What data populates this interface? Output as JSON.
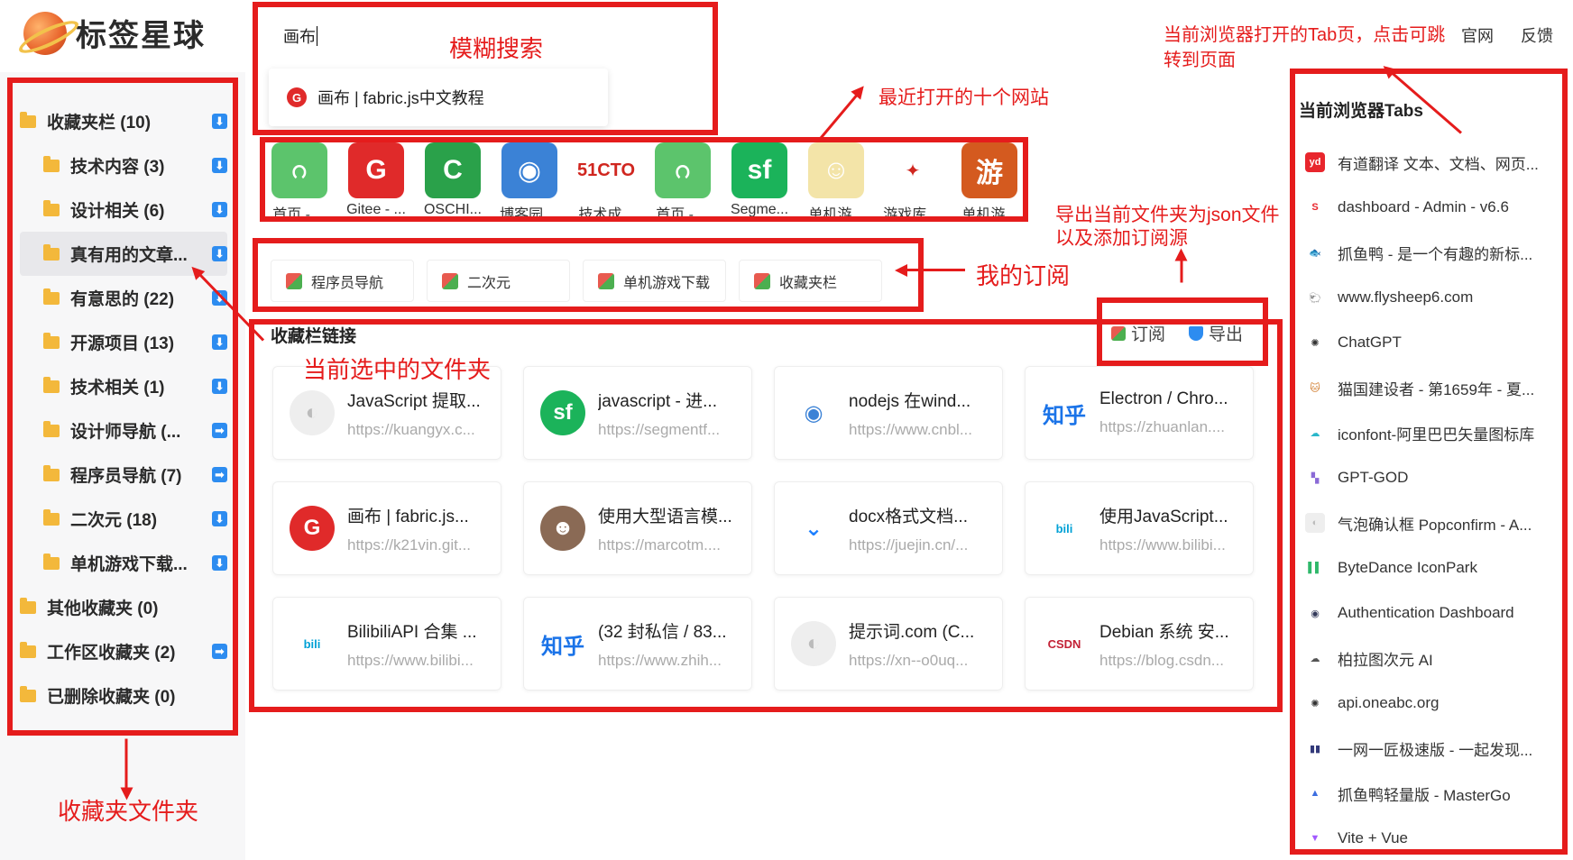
{
  "app": {
    "name": "标签星球"
  },
  "search": {
    "query": "画布",
    "result": "画布 | fabric.js中文教程"
  },
  "top_links": [
    "官网",
    "反馈"
  ],
  "sidebar": {
    "folders": [
      {
        "label": "收藏夹栏 (10)",
        "level": 0,
        "btn": "⬇"
      },
      {
        "label": "技术内容 (3)",
        "level": 1,
        "btn": "⬇"
      },
      {
        "label": "设计相关 (6)",
        "level": 1,
        "btn": "⬇"
      },
      {
        "label": "真有用的文章...",
        "level": 1,
        "btn": "⬇",
        "selected": true
      },
      {
        "label": "有意思的 (22)",
        "level": 1,
        "btn": "⬇"
      },
      {
        "label": "开源项目 (13)",
        "level": 1,
        "btn": "⬇"
      },
      {
        "label": "技术相关 (1)",
        "level": 1,
        "btn": "⬇"
      },
      {
        "label": "设计师导航 (...",
        "level": 1,
        "btn": "➡"
      },
      {
        "label": "程序员导航 (7)",
        "level": 1,
        "btn": "➡"
      },
      {
        "label": "二次元 (18)",
        "level": 1,
        "btn": "⬇"
      },
      {
        "label": "单机游戏下载...",
        "level": 1,
        "btn": "⬇"
      },
      {
        "label": "其他收藏夹 (0)",
        "level": 0,
        "btn": ""
      },
      {
        "label": "工作区收藏夹 (2)",
        "level": 0,
        "btn": "➡"
      },
      {
        "label": "已删除收藏夹 (0)",
        "level": 0,
        "btn": ""
      }
    ]
  },
  "recent_sites": [
    {
      "label": "首页 - ...",
      "glyph": "ဂ",
      "color": "#5cc46c"
    },
    {
      "label": "Gitee - ...",
      "glyph": "G",
      "color": "#e02a2a"
    },
    {
      "label": "OSCHI...",
      "glyph": "C",
      "color": "#2aa14a"
    },
    {
      "label": "博客园 ...",
      "glyph": "◉",
      "color": "#3b82d6"
    },
    {
      "label": "技术成...",
      "glyph": "51CTO",
      "color": "#ffffff"
    },
    {
      "label": "首页 - ...",
      "glyph": "ဂ",
      "color": "#5cc46c"
    },
    {
      "label": "Segme...",
      "glyph": "sf",
      "color": "#1bb35a"
    },
    {
      "label": "单机游...",
      "glyph": "☺",
      "color": "#f3e4a8"
    },
    {
      "label": "游戏库 ...",
      "glyph": "✦",
      "color": "#ffffff"
    },
    {
      "label": "单机游...",
      "glyph": "游",
      "color": "#d45a1f"
    }
  ],
  "subscriptions": [
    "程序员导航",
    "二次元",
    "单机游戏下载",
    "收藏夹栏"
  ],
  "section": {
    "title": "收藏栏链接",
    "subscribe": "订阅",
    "export": "导出"
  },
  "cards": [
    {
      "title": "JavaScript 提取...",
      "url": "https://kuangyx.c...",
      "glyph": "◐",
      "color": "#eeeeee",
      "fg": "#bbbbbb"
    },
    {
      "title": "javascript - 进...",
      "url": "https://segmentf...",
      "glyph": "sf",
      "color": "#1bb35a",
      "fg": "#ffffff"
    },
    {
      "title": "nodejs 在wind...",
      "url": "https://www.cnbl...",
      "glyph": "◉",
      "color": "#ffffff",
      "fg": "#3b82d6"
    },
    {
      "title": "Electron / Chro...",
      "url": "https://zhuanlan....",
      "glyph": "知乎",
      "color": "#ffffff",
      "fg": "#1a73e8"
    },
    {
      "title": "画布 | fabric.js...",
      "url": "https://k21vin.git...",
      "glyph": "G",
      "color": "#e02a2a",
      "fg": "#ffffff"
    },
    {
      "title": "使用大型语言模...",
      "url": "https://marcotm....",
      "glyph": "☻",
      "color": "#8a6a55",
      "fg": "#ffffff"
    },
    {
      "title": "docx格式文档...",
      "url": "https://juejin.cn/...",
      "glyph": "⌄",
      "color": "#ffffff",
      "fg": "#1e80ff"
    },
    {
      "title": "使用JavaScript...",
      "url": "https://www.bilibi...",
      "glyph": "bili",
      "color": "#ffffff",
      "fg": "#00a1d6"
    },
    {
      "title": "BilibiliAPI 合集 ...",
      "url": "https://www.bilibi...",
      "glyph": "bili",
      "color": "#ffffff",
      "fg": "#00a1d6"
    },
    {
      "title": "(32 封私信 / 83...",
      "url": "https://www.zhih...",
      "glyph": "知乎",
      "color": "#ffffff",
      "fg": "#1a73e8"
    },
    {
      "title": "提示词.com (C...",
      "url": "https://xn--o0uq...",
      "glyph": "◐",
      "color": "#eeeeee",
      "fg": "#bbbbbb"
    },
    {
      "title": "Debian 系统 安...",
      "url": "https://blog.csdn...",
      "glyph": "CSDN",
      "color": "#ffffff",
      "fg": "#c32136"
    }
  ],
  "tabs_panel": {
    "title": "当前浏览器Tabs",
    "tabs": [
      {
        "label": "有道翻译 文本、文档、网页...",
        "glyph": "yd",
        "color": "#e8262d",
        "fg": "#ffffff"
      },
      {
        "label": "dashboard - Admin - v6.6",
        "glyph": "S",
        "color": "#ffffff",
        "fg": "#e8262d"
      },
      {
        "label": "抓鱼鸭 - 是一个有趣的新标...",
        "glyph": "🐟",
        "color": "#ffffff",
        "fg": "#888888"
      },
      {
        "label": "www.flysheep6.com",
        "glyph": "🐑",
        "color": "#ffffff",
        "fg": "#c46a3a"
      },
      {
        "label": "ChatGPT",
        "glyph": "✺",
        "color": "#ffffff",
        "fg": "#333333"
      },
      {
        "label": "猫国建设者 - 第1659年 - 夏...",
        "glyph": "🐱",
        "color": "#ffffff",
        "fg": "#d07a2a"
      },
      {
        "label": "iconfont-阿里巴巴矢量图标库",
        "glyph": "☁",
        "color": "#ffffff",
        "fg": "#2ab7ca"
      },
      {
        "label": "GPT-GOD",
        "glyph": "▚",
        "color": "#ffffff",
        "fg": "#8a6ad6"
      },
      {
        "label": "气泡确认框 Popconfirm - A...",
        "glyph": "◐",
        "color": "#eeeeee",
        "fg": "#bbbbbb"
      },
      {
        "label": "ByteDance IconPark",
        "glyph": "▌▌",
        "color": "#ffffff",
        "fg": "#2fb86a"
      },
      {
        "label": "Authentication Dashboard",
        "glyph": "◉",
        "color": "#ffffff",
        "fg": "#333a5a"
      },
      {
        "label": "柏拉图次元 AI",
        "glyph": "☁",
        "color": "#ffffff",
        "fg": "#555555"
      },
      {
        "label": "api.oneabc.org",
        "glyph": "✺",
        "color": "#ffffff",
        "fg": "#333333"
      },
      {
        "label": "一网一匠极速版 - 一起发现...",
        "glyph": "▮▮",
        "color": "#ffffff",
        "fg": "#333a7a"
      },
      {
        "label": "抓鱼鸭轻量版 - MasterGo",
        "glyph": "▲",
        "color": "#ffffff",
        "fg": "#3b6de0"
      },
      {
        "label": "Vite + Vue",
        "glyph": "▼",
        "color": "#ffffff",
        "fg": "#a259ff"
      }
    ]
  },
  "annotations": {
    "fuzzy_search": "模糊搜索",
    "recent_ten": "最近打开的十个网站",
    "export_tip_line1": "导出当前文件夹为json文件",
    "export_tip_line2": "以及添加订阅源",
    "my_subs": "我的订阅",
    "current_folder": "当前选中的文件夹",
    "favorites": "收藏夹文件夹",
    "tabs_tip_line1": "当前浏览器打开的Tab页，点击可跳",
    "tabs_tip_line2": "转到页面"
  },
  "colors": {
    "accent": "#2d8cf0",
    "annotation": "#e51c1c",
    "folder": "#f3b83b"
  }
}
